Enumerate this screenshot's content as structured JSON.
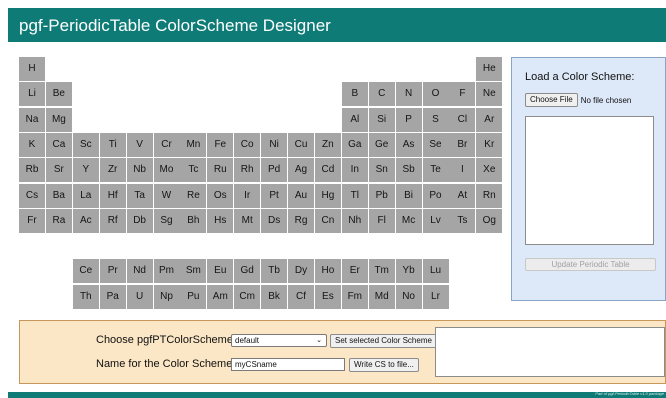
{
  "header": {
    "title": "pgf-PeriodicTable ColorScheme Designer"
  },
  "periodic_table": {
    "cell_color": "#a5a5a5",
    "rows": [
      [
        [
          0,
          "H"
        ],
        [
          17,
          "He"
        ]
      ],
      [
        [
          0,
          "Li"
        ],
        [
          1,
          "Be"
        ],
        [
          12,
          "B"
        ],
        [
          13,
          "C"
        ],
        [
          14,
          "N"
        ],
        [
          15,
          "O"
        ],
        [
          16,
          "F"
        ],
        [
          17,
          "Ne"
        ]
      ],
      [
        [
          0,
          "Na"
        ],
        [
          1,
          "Mg"
        ],
        [
          12,
          "Al"
        ],
        [
          13,
          "Si"
        ],
        [
          14,
          "P"
        ],
        [
          15,
          "S"
        ],
        [
          16,
          "Cl"
        ],
        [
          17,
          "Ar"
        ]
      ],
      [
        [
          0,
          "K"
        ],
        [
          1,
          "Ca"
        ],
        [
          2,
          "Sc"
        ],
        [
          3,
          "Ti"
        ],
        [
          4,
          "V"
        ],
        [
          5,
          "Cr"
        ],
        [
          6,
          "Mn"
        ],
        [
          7,
          "Fe"
        ],
        [
          8,
          "Co"
        ],
        [
          9,
          "Ni"
        ],
        [
          10,
          "Cu"
        ],
        [
          11,
          "Zn"
        ],
        [
          12,
          "Ga"
        ],
        [
          13,
          "Ge"
        ],
        [
          14,
          "As"
        ],
        [
          15,
          "Se"
        ],
        [
          16,
          "Br"
        ],
        [
          17,
          "Kr"
        ]
      ],
      [
        [
          0,
          "Rb"
        ],
        [
          1,
          "Sr"
        ],
        [
          2,
          "Y"
        ],
        [
          3,
          "Zr"
        ],
        [
          4,
          "Nb"
        ],
        [
          5,
          "Mo"
        ],
        [
          6,
          "Tc"
        ],
        [
          7,
          "Ru"
        ],
        [
          8,
          "Rh"
        ],
        [
          9,
          "Pd"
        ],
        [
          10,
          "Ag"
        ],
        [
          11,
          "Cd"
        ],
        [
          12,
          "In"
        ],
        [
          13,
          "Sn"
        ],
        [
          14,
          "Sb"
        ],
        [
          15,
          "Te"
        ],
        [
          16,
          "I"
        ],
        [
          17,
          "Xe"
        ]
      ],
      [
        [
          0,
          "Cs"
        ],
        [
          1,
          "Ba"
        ],
        [
          2,
          "La"
        ],
        [
          3,
          "Hf"
        ],
        [
          4,
          "Ta"
        ],
        [
          5,
          "W"
        ],
        [
          6,
          "Re"
        ],
        [
          7,
          "Os"
        ],
        [
          8,
          "Ir"
        ],
        [
          9,
          "Pt"
        ],
        [
          10,
          "Au"
        ],
        [
          11,
          "Hg"
        ],
        [
          12,
          "Tl"
        ],
        [
          13,
          "Pb"
        ],
        [
          14,
          "Bi"
        ],
        [
          15,
          "Po"
        ],
        [
          16,
          "At"
        ],
        [
          17,
          "Rn"
        ]
      ],
      [
        [
          0,
          "Fr"
        ],
        [
          1,
          "Ra"
        ],
        [
          2,
          "Ac"
        ],
        [
          3,
          "Rf"
        ],
        [
          4,
          "Db"
        ],
        [
          5,
          "Sg"
        ],
        [
          6,
          "Bh"
        ],
        [
          7,
          "Hs"
        ],
        [
          8,
          "Mt"
        ],
        [
          9,
          "Ds"
        ],
        [
          10,
          "Rg"
        ],
        [
          11,
          "Cn"
        ],
        [
          12,
          "Nh"
        ],
        [
          13,
          "Fl"
        ],
        [
          14,
          "Mc"
        ],
        [
          15,
          "Lv"
        ],
        [
          16,
          "Ts"
        ],
        [
          17,
          "Og"
        ]
      ],
      [],
      [
        [
          2,
          "Ce"
        ],
        [
          3,
          "Pr"
        ],
        [
          4,
          "Nd"
        ],
        [
          5,
          "Pm"
        ],
        [
          6,
          "Sm"
        ],
        [
          7,
          "Eu"
        ],
        [
          8,
          "Gd"
        ],
        [
          9,
          "Tb"
        ],
        [
          10,
          "Dy"
        ],
        [
          11,
          "Ho"
        ],
        [
          12,
          "Er"
        ],
        [
          13,
          "Tm"
        ],
        [
          14,
          "Yb"
        ],
        [
          15,
          "Lu"
        ]
      ],
      [
        [
          2,
          "Th"
        ],
        [
          3,
          "Pa"
        ],
        [
          4,
          "U"
        ],
        [
          5,
          "Np"
        ],
        [
          6,
          "Pu"
        ],
        [
          7,
          "Am"
        ],
        [
          8,
          "Cm"
        ],
        [
          9,
          "Bk"
        ],
        [
          10,
          "Cf"
        ],
        [
          11,
          "Es"
        ],
        [
          12,
          "Fm"
        ],
        [
          13,
          "Md"
        ],
        [
          14,
          "No"
        ],
        [
          15,
          "Lr"
        ]
      ]
    ]
  },
  "load_panel": {
    "title": "Load a Color Scheme:",
    "choose_file_label": "Choose File",
    "file_status": "No file chosen",
    "update_label": "Update Periodic Table"
  },
  "choose_panel": {
    "scheme_label": "Choose pgfPTColorScheme:",
    "scheme_selected": "default",
    "set_scheme_label": "Set selected Color Scheme",
    "name_label": "Name for the Color Scheme:",
    "name_value": "myCSname",
    "write_label": "Write CS to file..."
  },
  "footer": {
    "credit": "Part of pgf-PeriodicTable v1.0 package"
  },
  "colors": {
    "accent": "#0e7b76",
    "load_panel_bg": "#dde8f8",
    "choose_panel_bg": "#fbe7c6"
  }
}
